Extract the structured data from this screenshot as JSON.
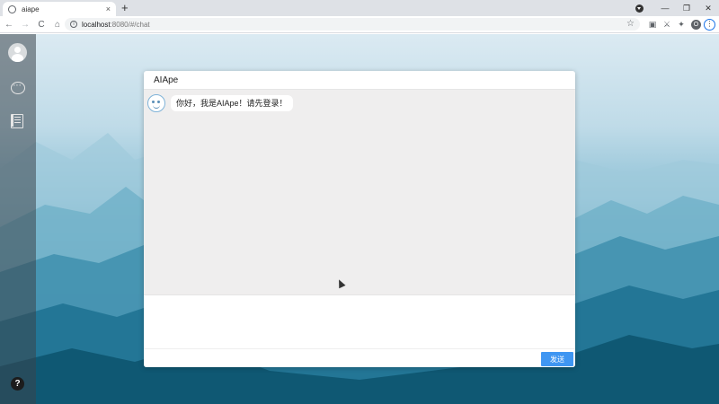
{
  "browser": {
    "tab_title": "aiape",
    "tab_close": "×",
    "new_tab": "+",
    "window_controls": {
      "minimize": "—",
      "restore": "❐",
      "close": "✕"
    },
    "nav": {
      "back": "←",
      "forward": "→",
      "reload": "C",
      "home": "⌂"
    },
    "url_host": "localhost",
    "url_path": ":8080/#/chat",
    "profile_initial": "O",
    "menu": "⋮",
    "icons": {
      "bookmark": "star-icon",
      "extensions": "puzzle-icon",
      "site_info": "info-icon"
    }
  },
  "sidebar": {
    "items": [
      {
        "name": "user-avatar"
      },
      {
        "name": "chat-icon"
      },
      {
        "name": "notes-icon"
      }
    ],
    "help_label": "?"
  },
  "chat": {
    "title": "AIApe",
    "messages": [
      {
        "sender": "bot",
        "text": "你好，我是AIApe！请先登录！"
      }
    ],
    "input_placeholder": "",
    "send_label": "发送"
  },
  "colors": {
    "accent": "#3f96f2",
    "sidebar": "#3a444a",
    "chat_bg": "#efeeee"
  }
}
